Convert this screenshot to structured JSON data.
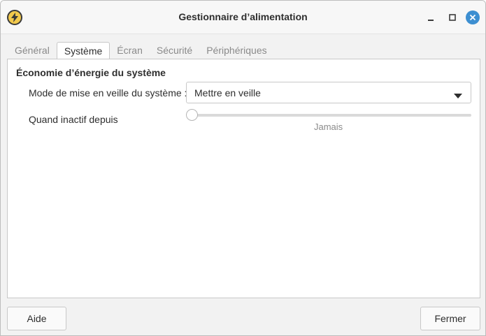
{
  "window": {
    "title": "Gestionnaire d’alimentation",
    "app_icon": "power-manager-icon",
    "controls": [
      "minimize-icon",
      "maximize-icon",
      "close-icon"
    ]
  },
  "tabs": [
    {
      "label": "Général",
      "active": false
    },
    {
      "label": "Système",
      "active": true
    },
    {
      "label": "Écran",
      "active": false
    },
    {
      "label": "Sécurité",
      "active": false
    },
    {
      "label": "Périphériques",
      "active": false
    }
  ],
  "system": {
    "section_title": "Économie d’énergie du système",
    "sleep_mode": {
      "label": "Mode de mise en veille du système :",
      "value": "Mettre en veille"
    },
    "inactive": {
      "label": "Quand inactif depuis",
      "value_text": "Jamais",
      "slider_fraction": 0
    }
  },
  "footer": {
    "help_label": "Aide",
    "close_label": "Fermer"
  },
  "colors": {
    "accent": "#3d8fd1",
    "app_icon_fill": "#f2c94c"
  }
}
